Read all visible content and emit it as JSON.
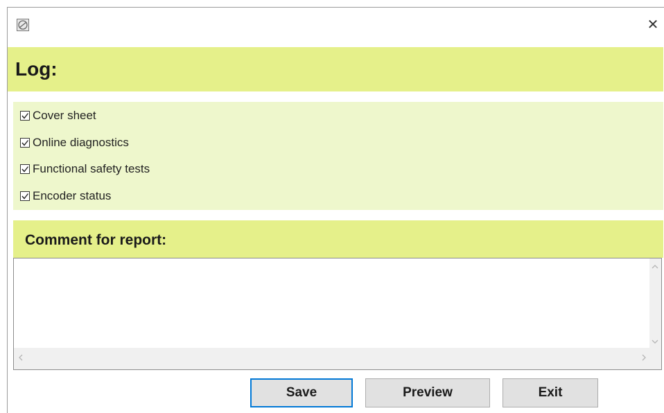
{
  "window": {
    "close_glyph": "✕"
  },
  "log": {
    "title": "Log:"
  },
  "options": [
    {
      "label": "Cover sheet",
      "checked": true
    },
    {
      "label": "Online diagnostics",
      "checked": true
    },
    {
      "label": "Functional safety tests",
      "checked": true
    },
    {
      "label": "Encoder status",
      "checked": true
    }
  ],
  "comment": {
    "title": "Comment for report:",
    "value": ""
  },
  "buttons": {
    "save": "Save",
    "preview": "Preview",
    "exit": "Exit"
  },
  "colors": {
    "header_bg": "#e5f08a",
    "panel_bg": "#eef7cc",
    "default_button_border": "#0078d7"
  },
  "icons": {
    "app": "app-logo-icon",
    "close": "close-icon",
    "check": "checkmark-icon",
    "scroll_up": "scroll-up-arrow-icon",
    "scroll_down": "scroll-down-arrow-icon",
    "scroll_left": "scroll-left-arrow-icon",
    "scroll_right": "scroll-right-arrow-icon"
  }
}
